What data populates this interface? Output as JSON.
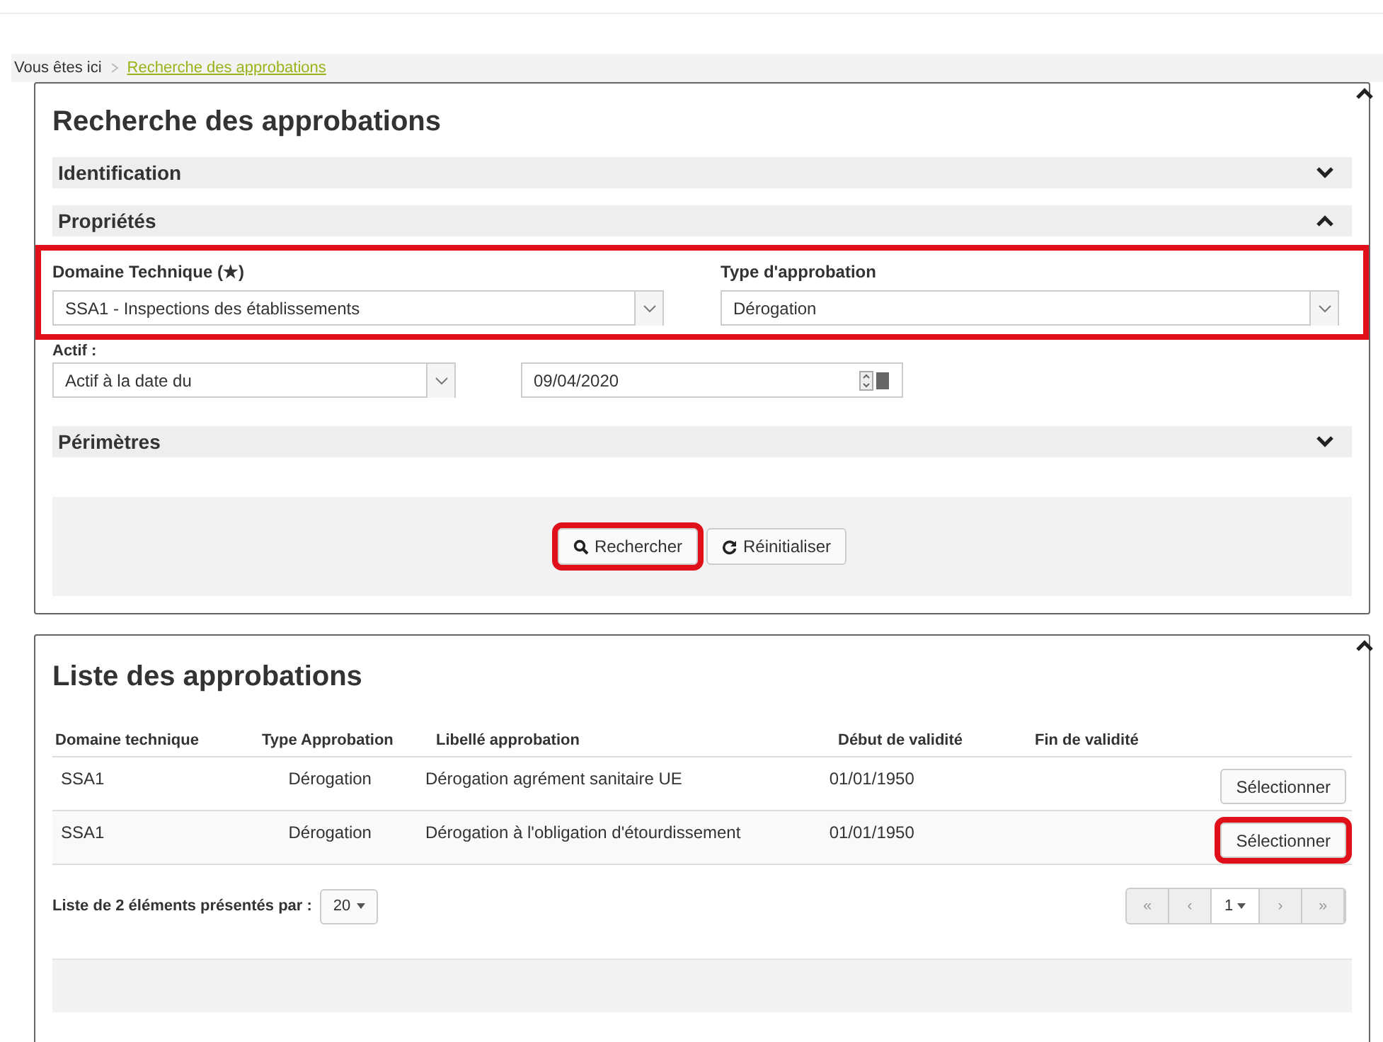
{
  "breadcrumb": {
    "label": "Vous êtes ici",
    "current": "Recherche des approbations"
  },
  "search_panel": {
    "title": "Recherche des approbations",
    "expanded": true,
    "sections": [
      {
        "title": "Identification",
        "expanded": false
      },
      {
        "title": "Propriétés",
        "expanded": true
      }
    ],
    "filters_highlighted": true,
    "domaine": {
      "label": "Domaine Technique (★)",
      "value": "SSA1 - Inspections des établissements"
    },
    "type": {
      "label": "Type d'approbation",
      "value": "Dérogation"
    },
    "actif": {
      "label": "Actif :",
      "value": "Actif à la date du",
      "date": "09/04/2020"
    },
    "perimetres": {
      "title": "Périmètres",
      "expanded": false
    },
    "buttons": [
      {
        "label": "Rechercher",
        "highlighted": true
      },
      {
        "label": "Réinitialiser",
        "highlighted": false
      }
    ]
  },
  "list_panel": {
    "title": "Liste des approbations",
    "expanded": true,
    "columns": [
      "Domaine technique",
      "Type Approbation",
      "Libellé approbation",
      "Début de validité",
      "Fin de validité"
    ],
    "rows": [
      {
        "cells": [
          "SSA1",
          "Dérogation",
          "Dérogation agrément sanitaire UE",
          "01/01/1950",
          ""
        ],
        "action": "Sélectionner",
        "highlighted": false
      },
      {
        "cells": [
          "SSA1",
          "Dérogation",
          "Dérogation à l'obligation d'étourdissement",
          "01/01/1950",
          ""
        ],
        "action": "Sélectionner",
        "highlighted": true
      }
    ],
    "summary": "Liste de 2 éléments présentés par :",
    "page_size": "20",
    "page": "1",
    "pager": [
      "«",
      "‹",
      "›",
      "»"
    ]
  }
}
